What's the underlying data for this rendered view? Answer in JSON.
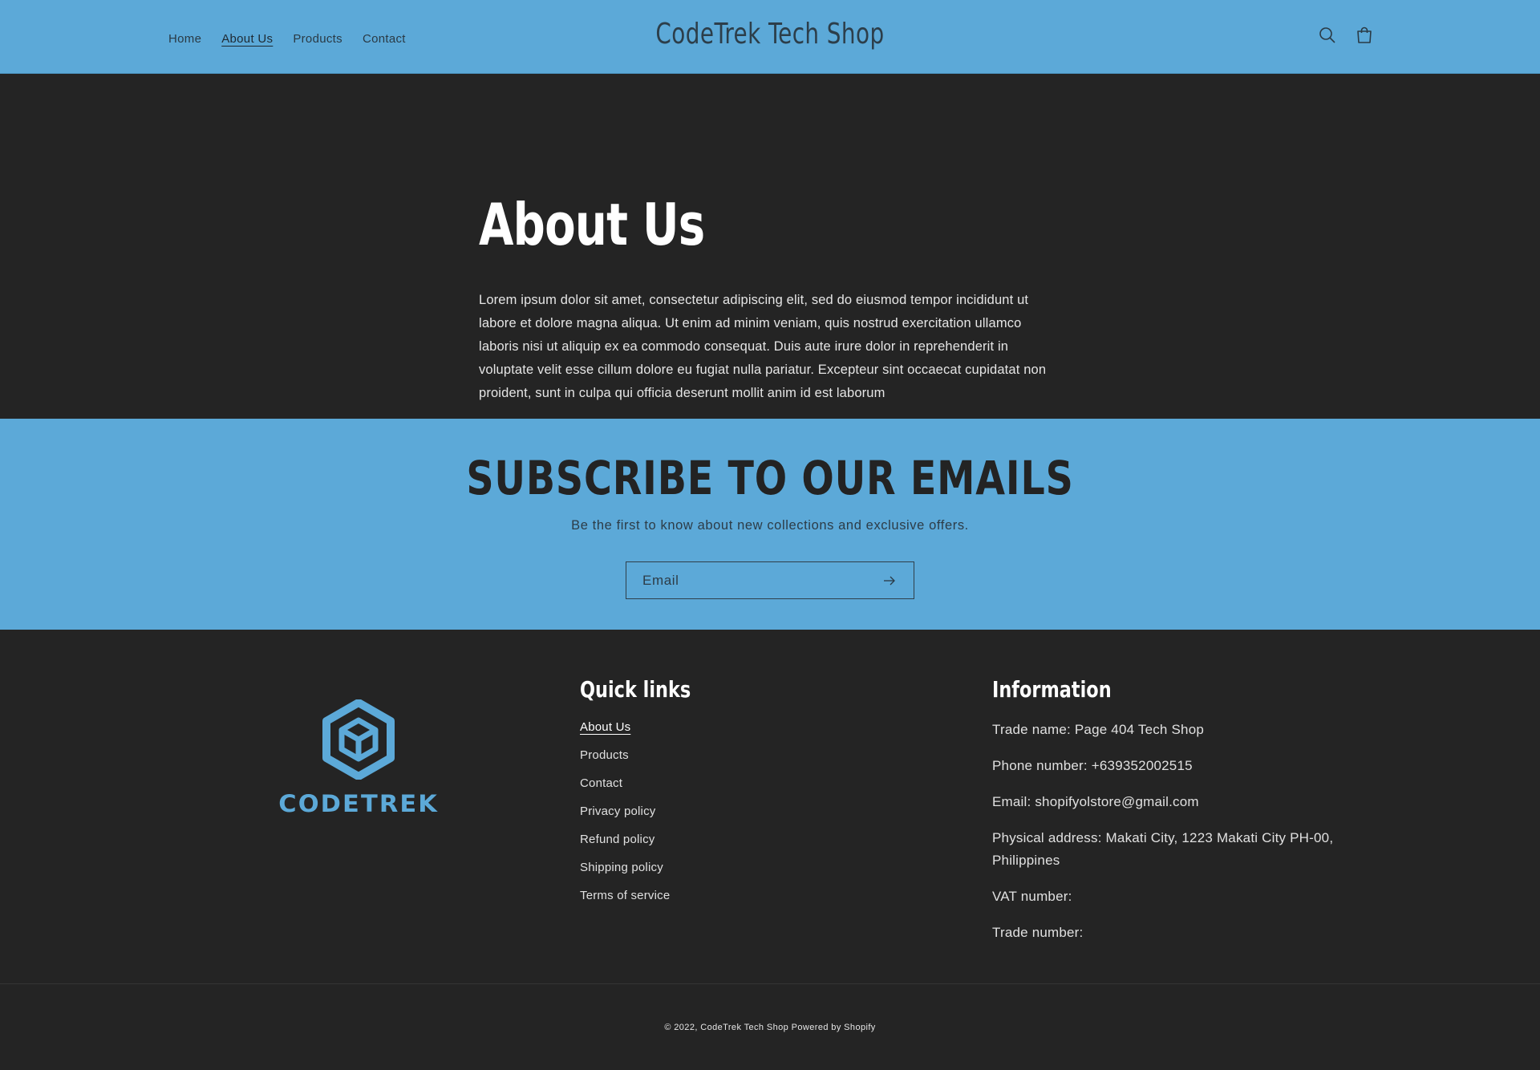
{
  "header": {
    "nav": [
      "Home",
      "About Us",
      "Products",
      "Contact"
    ],
    "active_nav": "About Us",
    "brand": "CodeTrek Tech Shop",
    "search_icon": "search-icon",
    "cart_icon": "cart-icon",
    "bg_color": "#5ca9d8"
  },
  "about": {
    "title": "About Us",
    "body": "Lorem ipsum dolor sit amet, consectetur adipiscing elit, sed do eiusmod tempor incididunt ut labore et dolore magna aliqua. Ut enim ad minim veniam, quis nostrud exercitation ullamco laboris nisi ut aliquip ex ea commodo consequat. Duis aute irure dolor in reprehenderit in voluptate velit esse cillum dolore eu fugiat nulla pariatur. Excepteur sint occaecat cupidatat non proident, sunt in culpa qui officia deserunt mollit anim id est laborum"
  },
  "subscribe": {
    "title": "SUBSCRIBE TO OUR EMAILS",
    "text": "Be the first to know about new collections and exclusive offers.",
    "email_placeholder": "Email",
    "submit_icon": "arrow-right-icon"
  },
  "footer": {
    "logo_text": "CODETREK",
    "quick_links": {
      "title": "Quick links",
      "items": [
        "About Us",
        "Products",
        "Contact",
        "Privacy policy",
        "Refund policy",
        "Shipping policy",
        "Terms of service"
      ]
    },
    "information": {
      "title": "Information",
      "lines": [
        "Trade name: Page 404 Tech Shop",
        "Phone number: +639352002515",
        "Email: shopifyolstore@gmail.com",
        "Physical address: Makati City, 1223 Makati City PH-00, Philippines",
        "VAT number:",
        "Trade number:"
      ]
    },
    "copyright": "© 2022, CodeTrek Tech Shop Powered by Shopify",
    "accent_color": "#5ca9d8"
  }
}
